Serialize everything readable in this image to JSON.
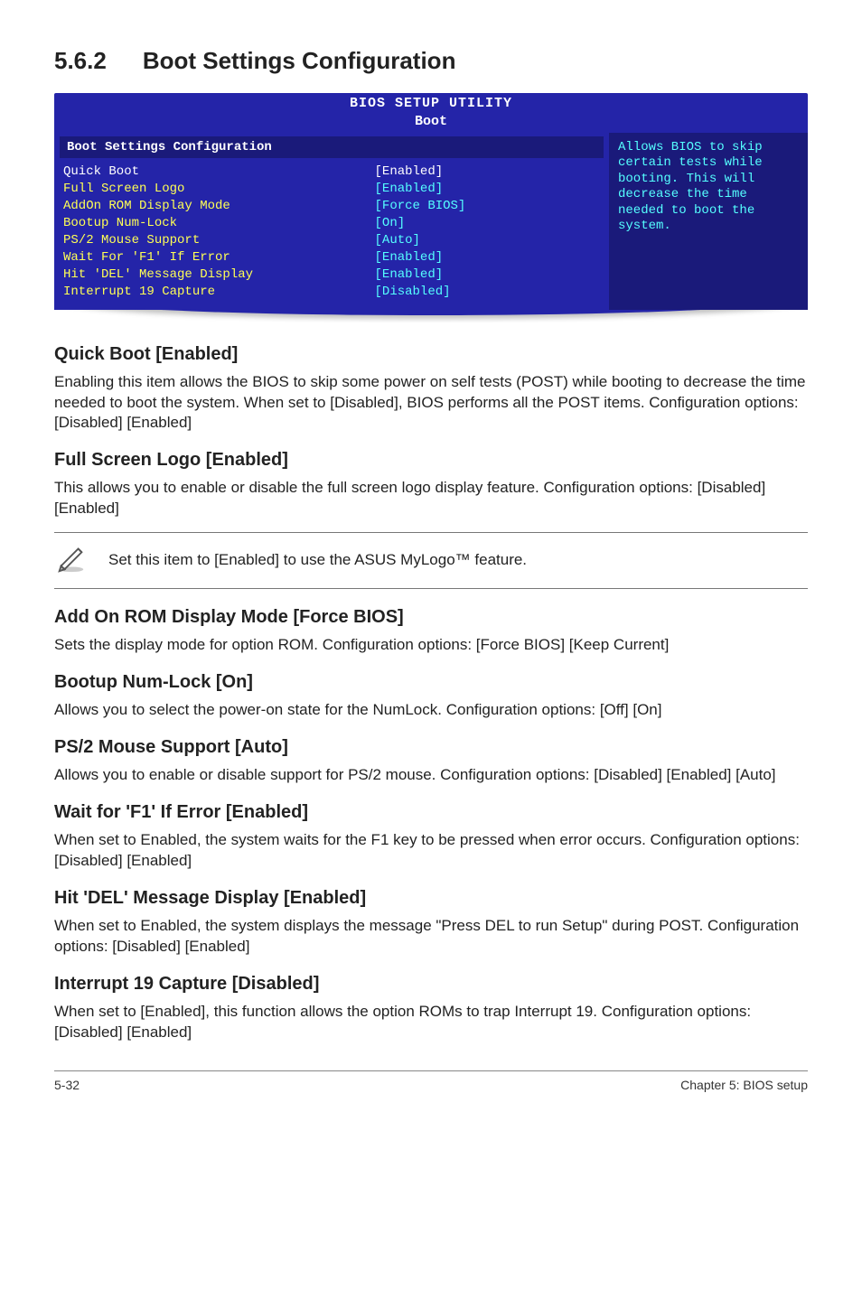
{
  "section": {
    "number": "5.6.2",
    "title": "Boot Settings Configuration"
  },
  "bios": {
    "header1": "BIOS SETUP UTILITY",
    "header2": "Boot",
    "panel_title": "Boot Settings Configuration",
    "rows": [
      {
        "label": "Quick Boot",
        "value": "[Enabled]",
        "selected": true
      },
      {
        "label": "Full Screen Logo",
        "value": "[Enabled]"
      },
      {
        "label": "AddOn ROM Display Mode",
        "value": "[Force BIOS]"
      },
      {
        "label": "Bootup Num-Lock",
        "value": "[On]"
      },
      {
        "label": "PS/2 Mouse Support",
        "value": "[Auto]"
      },
      {
        "label": "Wait For 'F1' If Error",
        "value": "[Enabled]"
      },
      {
        "label": "Hit 'DEL' Message Display",
        "value": "[Enabled]"
      },
      {
        "label": "Interrupt 19 Capture",
        "value": "[Disabled]"
      }
    ],
    "help": "Allows BIOS to skip certain tests while booting. This will decrease the time needed to boot the system."
  },
  "items": {
    "quickboot": {
      "title": "Quick Boot [Enabled]",
      "body": "Enabling this item allows the BIOS to skip some power on self tests (POST) while booting to decrease the time needed to boot the system. When set to [Disabled], BIOS performs all the POST items. Configuration options: [Disabled] [Enabled]"
    },
    "fullscreen": {
      "title": "Full Screen Logo [Enabled]",
      "body": "This allows you to enable or disable the full screen logo display feature. Configuration options: [Disabled] [Enabled]"
    },
    "note": "Set this item to [Enabled] to use the ASUS MyLogo™ feature.",
    "addon": {
      "title": "Add On ROM Display Mode [Force BIOS]",
      "body": "Sets the display mode for option ROM. Configuration options: [Force BIOS] [Keep Current]"
    },
    "numlock": {
      "title": "Bootup Num-Lock [On]",
      "body": "Allows you to select the power-on state for the NumLock. Configuration options: [Off] [On]"
    },
    "ps2": {
      "title": "PS/2 Mouse Support [Auto]",
      "body": "Allows you to enable or disable support for PS/2 mouse. Configuration options: [Disabled] [Enabled] [Auto]"
    },
    "waitf1": {
      "title": "Wait for 'F1' If Error [Enabled]",
      "body": "When set to Enabled, the system waits for the F1 key to be pressed when error occurs. Configuration options: [Disabled] [Enabled]"
    },
    "hitdel": {
      "title": "Hit 'DEL' Message Display [Enabled]",
      "body": "When set to Enabled, the system displays the message \"Press DEL to run Setup\" during POST. Configuration options: [Disabled] [Enabled]"
    },
    "int19": {
      "title": "Interrupt 19 Capture [Disabled]",
      "body": "When set to [Enabled], this function allows the option ROMs to trap Interrupt 19. Configuration options: [Disabled] [Enabled]"
    }
  },
  "footer": {
    "left": "5-32",
    "right": "Chapter 5: BIOS setup"
  }
}
